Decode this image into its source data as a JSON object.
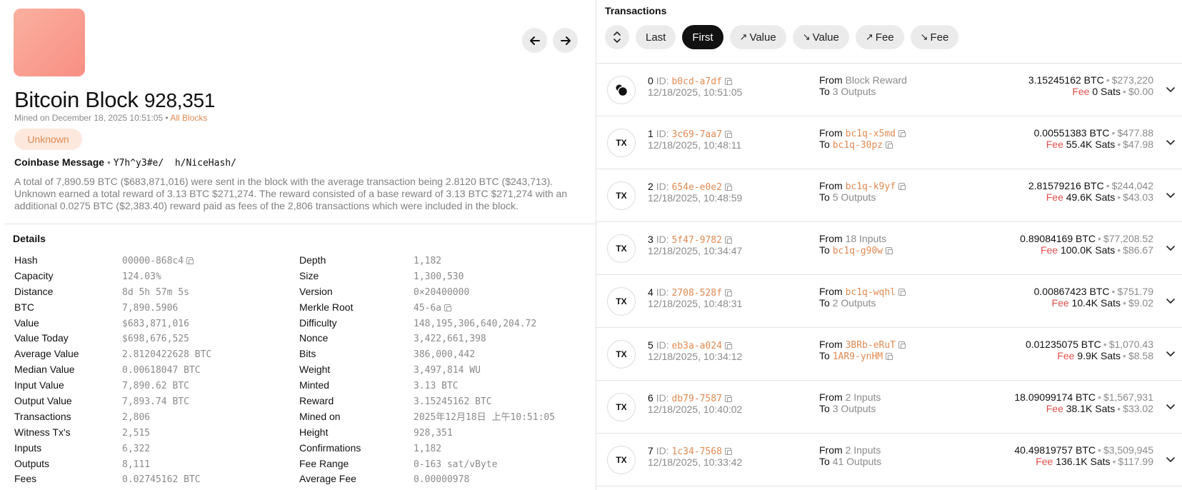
{
  "nav": {
    "prev_icon": "arrow-left-icon",
    "next_icon": "arrow-right-icon"
  },
  "block": {
    "title": "Bitcoin Block",
    "number": "928,351",
    "mined_text": "Mined on December 18, 2025 10:51:05",
    "bullet": "•",
    "all_blocks_link": "All Blocks",
    "pool": "Unknown",
    "coinbase_label": "Coinbase Message",
    "coinbase_value": "Y7h^y3#e/  h/NiceHash/",
    "summary": "A total of 7,890.59 BTC ($683,871,016) were sent in the block with the average transaction being 2.8120 BTC ($243,713). Unknown earned a total reward of 3.13 BTC $271,274. The reward consisted of a base reward of 3.13 BTC $271,274 with an additional 0.0275 BTC ($2,383.40) reward paid as fees of the 2,806 transactions which were included in the block."
  },
  "details": {
    "heading": "Details",
    "col1": [
      {
        "k": "Hash",
        "v": "00000-868c4",
        "copy": true
      },
      {
        "k": "Capacity",
        "v": "124.03%"
      },
      {
        "k": "Distance",
        "v": "8d 5h 57m 5s"
      },
      {
        "k": "BTC",
        "v": "7,890.5906"
      },
      {
        "k": "Value",
        "v": "$683,871,016"
      },
      {
        "k": "Value Today",
        "v": "$698,676,525"
      },
      {
        "k": "Average Value",
        "v": "2.8120422628 BTC"
      },
      {
        "k": "Median Value",
        "v": "0.00618047 BTC"
      },
      {
        "k": "Input Value",
        "v": "7,890.62 BTC"
      },
      {
        "k": "Output Value",
        "v": "7,893.74 BTC"
      },
      {
        "k": "Transactions",
        "v": "2,806"
      },
      {
        "k": "Witness Tx's",
        "v": "2,515"
      },
      {
        "k": "Inputs",
        "v": "6,322"
      },
      {
        "k": "Outputs",
        "v": "8,111"
      },
      {
        "k": "Fees",
        "v": "0.02745162 BTC"
      }
    ],
    "col2": [
      {
        "k": "Depth",
        "v": "1,182"
      },
      {
        "k": "Size",
        "v": "1,300,530"
      },
      {
        "k": "Version",
        "v": "0×20400000"
      },
      {
        "k": "Merkle Root",
        "v": "45-6a",
        "copy": true
      },
      {
        "k": "Difficulty",
        "v": "148,195,306,640,204.72"
      },
      {
        "k": "Nonce",
        "v": "3,422,661,398"
      },
      {
        "k": "Bits",
        "v": "386,000,442"
      },
      {
        "k": "Weight",
        "v": "3,497,814 WU"
      },
      {
        "k": "Minted",
        "v": "3.13 BTC"
      },
      {
        "k": "Reward",
        "v": "3.15245162 BTC"
      },
      {
        "k": "Mined on",
        "v": "2025年12月18日 上午10:51:05"
      },
      {
        "k": "Height",
        "v": "928,351"
      },
      {
        "k": "Confirmations",
        "v": "1,182"
      },
      {
        "k": "Fee Range",
        "v": "0-163 sat/vByte"
      },
      {
        "k": "Average Fee",
        "v": "0.00000978"
      }
    ]
  },
  "transactions": {
    "heading": "Transactions",
    "sort_icon": "sort-vertical-icon",
    "sort_options": [
      {
        "label": "Last",
        "arrow": "",
        "active": false
      },
      {
        "label": "First",
        "arrow": "",
        "active": true
      },
      {
        "label": "Value",
        "arrow": "↗",
        "active": false
      },
      {
        "label": "Value",
        "arrow": "↘",
        "active": false
      },
      {
        "label": "Fee",
        "arrow": "↗",
        "active": false
      },
      {
        "label": "Fee",
        "arrow": "↘",
        "active": false
      }
    ],
    "id_label": "ID:",
    "from_label": "From",
    "to_label": "To",
    "fee_label": "Fee",
    "items": [
      {
        "index": "0",
        "badge": "",
        "id": "b0cd-a7df",
        "time": "12/18/2025, 10:51:05",
        "from": "Block Reward",
        "from_link": false,
        "to": "3 Outputs",
        "to_link": false,
        "btc": "3.15245162 BTC",
        "usd": "$273,220",
        "fee": "0 Sats",
        "fee_usd": "$0.00"
      },
      {
        "index": "1",
        "badge": "TX",
        "id": "3c69-7aa7",
        "time": "12/18/2025, 10:48:11",
        "from": "bc1q-x5md",
        "from_link": true,
        "to": "bc1q-30pz",
        "to_link": true,
        "btc": "0.00551383 BTC",
        "usd": "$477.88",
        "fee": "55.4K Sats",
        "fee_usd": "$47.98"
      },
      {
        "index": "2",
        "badge": "TX",
        "id": "654e-e0e2",
        "time": "12/18/2025, 10:48:59",
        "from": "bc1q-k9yf",
        "from_link": true,
        "to": "5 Outputs",
        "to_link": false,
        "btc": "2.81579216 BTC",
        "usd": "$244,042",
        "fee": "49.6K Sats",
        "fee_usd": "$43.03"
      },
      {
        "index": "3",
        "badge": "TX",
        "id": "5f47-9782",
        "time": "12/18/2025, 10:34:47",
        "from": "18 Inputs",
        "from_link": false,
        "to": "bc1q-g90w",
        "to_link": true,
        "btc": "0.89084169 BTC",
        "usd": "$77,208.52",
        "fee": "100.0K Sats",
        "fee_usd": "$86.67"
      },
      {
        "index": "4",
        "badge": "TX",
        "id": "2708-528f",
        "time": "12/18/2025, 10:48:31",
        "from": "bc1q-wqhl",
        "from_link": true,
        "to": "2 Outputs",
        "to_link": false,
        "btc": "0.00867423 BTC",
        "usd": "$751.79",
        "fee": "10.4K Sats",
        "fee_usd": "$9.02"
      },
      {
        "index": "5",
        "badge": "TX",
        "id": "eb3a-a024",
        "time": "12/18/2025, 10:34:12",
        "from": "3BRb-eRuT",
        "from_link": true,
        "to": "1AR9-ynHM",
        "to_link": true,
        "btc": "0.01235075 BTC",
        "usd": "$1,070.43",
        "fee": "9.9K Sats",
        "fee_usd": "$8.58"
      },
      {
        "index": "6",
        "badge": "TX",
        "id": "db79-7587",
        "time": "12/18/2025, 10:40:02",
        "from": "2 Inputs",
        "from_link": false,
        "to": "3 Outputs",
        "to_link": false,
        "btc": "18.09099174 BTC",
        "usd": "$1,567,931",
        "fee": "38.1K Sats",
        "fee_usd": "$33.02"
      },
      {
        "index": "7",
        "badge": "TX",
        "id": "1c34-7568",
        "time": "12/18/2025, 10:33:42",
        "from": "2 Inputs",
        "from_link": false,
        "to": "41 Outputs",
        "to_link": false,
        "btc": "40.49819757 BTC",
        "usd": "$3,509,945",
        "fee": "136.1K Sats",
        "fee_usd": "$117.99"
      }
    ]
  },
  "colors": {
    "accent": "#e08a52",
    "fee": "#e0504d",
    "muted": "#8a8a8a",
    "thumb_from": "#fbb0a0",
    "thumb_to": "#f78f83"
  }
}
